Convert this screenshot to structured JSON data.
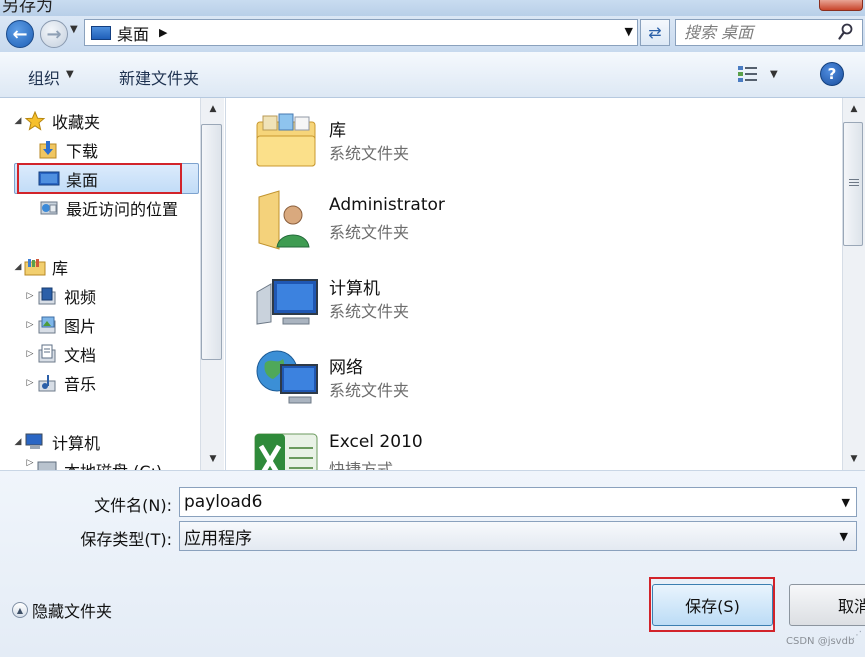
{
  "window": {
    "title": "另存为"
  },
  "nav": {
    "address_path": "桌面",
    "search_placeholder": "搜索 桌面",
    "icons": {
      "back": "back-arrow-icon",
      "forward": "forward-arrow-icon",
      "refresh": "refresh-icon",
      "search": "search-icon"
    }
  },
  "toolbar": {
    "organize_label": "组织",
    "new_folder_label": "新建文件夹",
    "help_label": "?"
  },
  "navpane": {
    "favorites": {
      "label": "收藏夹",
      "items": [
        {
          "label": "下载",
          "icon": "download-folder-icon"
        },
        {
          "label": "桌面",
          "icon": "desktop-icon",
          "selected": true
        },
        {
          "label": "最近访问的位置",
          "icon": "recent-places-icon"
        }
      ]
    },
    "libraries": {
      "label": "库",
      "items": [
        {
          "label": "视频",
          "icon": "videos-library-icon"
        },
        {
          "label": "图片",
          "icon": "pictures-library-icon"
        },
        {
          "label": "文档",
          "icon": "documents-library-icon"
        },
        {
          "label": "音乐",
          "icon": "music-library-icon"
        }
      ]
    },
    "computer": {
      "label": "计算机",
      "items": [
        {
          "label": "本地磁盘 (C:)",
          "icon": "local-disk-icon"
        }
      ]
    }
  },
  "content": {
    "items": [
      {
        "name": "库",
        "type": "系统文件夹",
        "icon": "libraries-folder-icon"
      },
      {
        "name": "Administrator",
        "type": "系统文件夹",
        "icon": "user-folder-icon"
      },
      {
        "name": "计算机",
        "type": "系统文件夹",
        "icon": "computer-icon"
      },
      {
        "name": "网络",
        "type": "系统文件夹",
        "icon": "network-icon"
      },
      {
        "name": "Excel 2010",
        "type": "快捷方式",
        "icon": "excel-icon"
      }
    ]
  },
  "form": {
    "filename_label": "文件名(N):",
    "filename_value": "payload6",
    "filetype_label": "保存类型(T):",
    "filetype_value": "应用程序",
    "hide_folders_label": "隐藏文件夹",
    "save_label": "保存(S)",
    "cancel_label": "取消"
  },
  "watermark": "CSDN @jsvdb",
  "colors": {
    "highlight_box": "#d2232a",
    "selection": "#c1dcf7",
    "accent": "#1e5fb5"
  }
}
